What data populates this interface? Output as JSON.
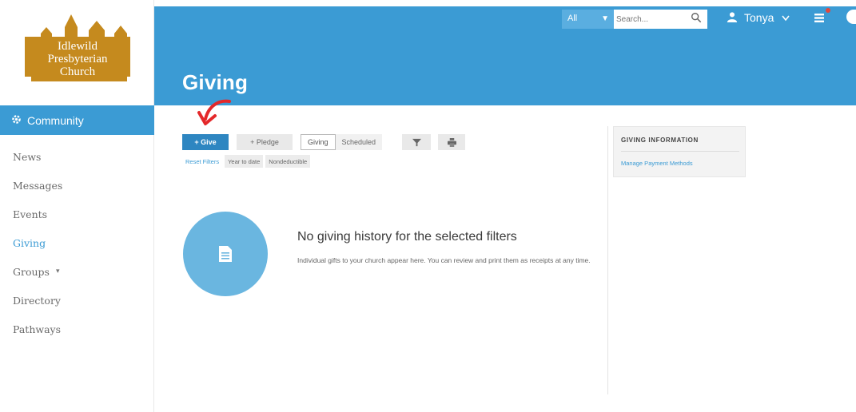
{
  "logo": {
    "line1": "Idlewild",
    "line2": "Presbyterian",
    "line3": "Church",
    "color": "#c58a1e"
  },
  "colors": {
    "primary": "#3b9bd4",
    "give_button": "#2e86c1",
    "arrow": "#e4282a"
  },
  "header": {
    "title": "Giving",
    "scope": "All",
    "search_placeholder": "Search...",
    "user_name": "Tonya"
  },
  "sidebar": {
    "section": "Community",
    "items": [
      {
        "label": "News"
      },
      {
        "label": "Messages"
      },
      {
        "label": "Events"
      },
      {
        "label": "Giving"
      },
      {
        "label": "Groups"
      },
      {
        "label": "Directory"
      },
      {
        "label": "Pathways"
      }
    ]
  },
  "toolbar": {
    "give": "+ Give",
    "pledge": "+ Pledge",
    "tab_giving": "Giving",
    "tab_scheduled": "Scheduled"
  },
  "filters": {
    "reset": "Reset Filters",
    "year_to_date": "Year to date",
    "nondeductible": "Nondeductible"
  },
  "empty": {
    "title": "No giving history for the selected filters",
    "text": "Individual gifts to your church appear here. You can review and print them as receipts at any time."
  },
  "panel": {
    "title": "GIVING INFORMATION",
    "link": "Manage Payment Methods"
  }
}
